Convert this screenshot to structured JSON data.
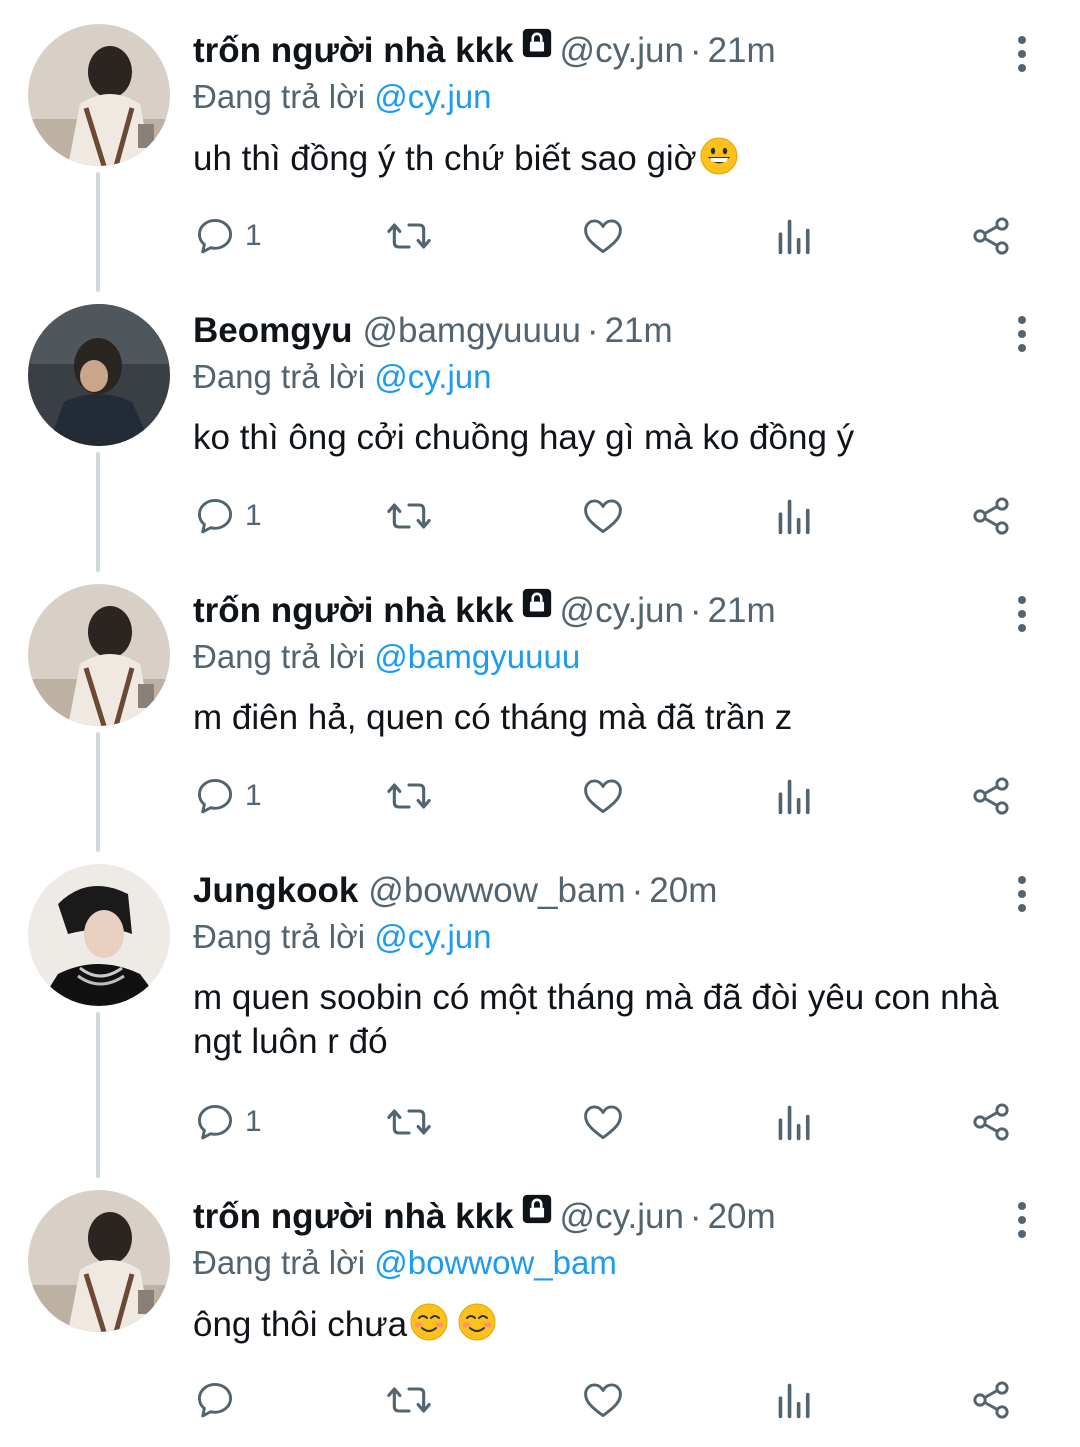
{
  "colors": {
    "link": "#1d9bf0",
    "secondary_text": "#536471",
    "primary_text": "#0f1419",
    "thread_line": "#cfd9de"
  },
  "tweets": [
    {
      "avatar": "avatar-cy-jun",
      "name": "trốn người nhà kkk",
      "locked": true,
      "handle": "@cy.jun",
      "dot": "·",
      "time": "21m",
      "replying_label": "Đang trả lời",
      "replying_to": "@cy.jun",
      "text": "uh thì đồng ý th chứ biết sao giờ",
      "emoji": [
        "grinning-face-emoji"
      ],
      "reply_count": "1"
    },
    {
      "avatar": "avatar-beomgyu",
      "name": "Beomgyu",
      "locked": false,
      "handle": "@bamgyuuuu",
      "dot": "·",
      "time": "21m",
      "replying_label": "Đang trả lời",
      "replying_to": "@cy.jun",
      "text": "ko thì ông cởi chuồng hay gì mà ko đồng ý",
      "emoji": [],
      "reply_count": "1"
    },
    {
      "avatar": "avatar-cy-jun",
      "name": "trốn người nhà kkk",
      "locked": true,
      "handle": "@cy.jun",
      "dot": "·",
      "time": "21m",
      "replying_label": "Đang trả lời",
      "replying_to": "@bamgyuuuu",
      "text": "m điên hả, quen có tháng mà đã trần z",
      "emoji": [],
      "reply_count": "1"
    },
    {
      "avatar": "avatar-jungkook",
      "name": "Jungkook",
      "locked": false,
      "handle": "@bowwow_bam",
      "dot": "·",
      "time": "20m",
      "replying_label": "Đang trả lời",
      "replying_to": "@cy.jun",
      "text": "m quen soobin có một tháng mà đã đòi yêu con nhà ngt luôn r đó",
      "emoji": [],
      "reply_count": "1"
    },
    {
      "avatar": "avatar-cy-jun",
      "name": "trốn người nhà kkk",
      "locked": true,
      "handle": "@cy.jun",
      "dot": "·",
      "time": "20m",
      "replying_label": "Đang trả lời",
      "replying_to": "@bowwow_bam",
      "text": "ông thôi chưa",
      "emoji": [
        "smiling-face-emoji",
        "smiling-face-emoji"
      ],
      "reply_count": ""
    }
  ]
}
